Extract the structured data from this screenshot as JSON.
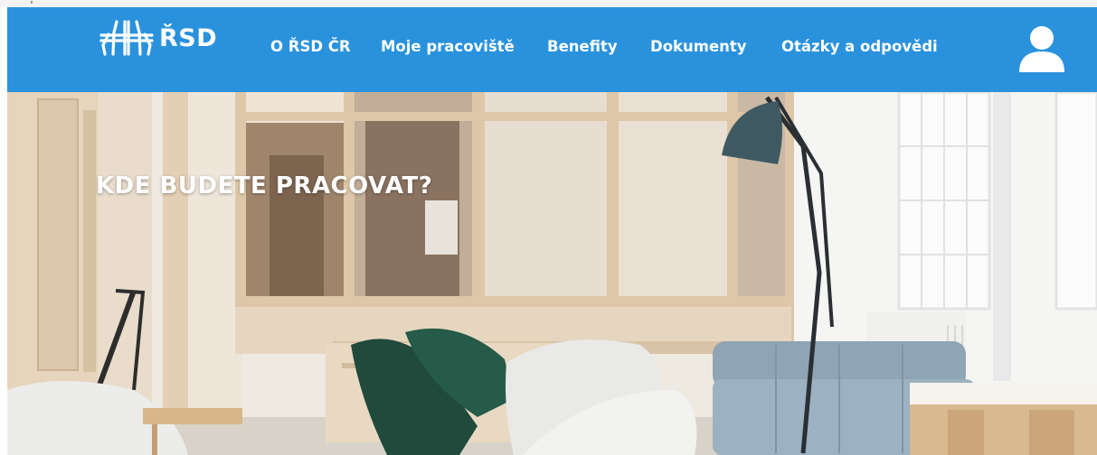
{
  "brand": {
    "logo_text": "ŘSD",
    "logo_icon": "highway-logo-icon"
  },
  "nav": {
    "items": [
      {
        "label": "O ŘSD ČR"
      },
      {
        "label": "Moje pracoviště"
      },
      {
        "label": "Benefity"
      },
      {
        "label": "Dokumenty"
      },
      {
        "label": "Otázky a odpovědi"
      }
    ],
    "user_icon": "user-icon"
  },
  "hero": {
    "title": "KDE BUDETE PRACOVAT?",
    "image": "office-interior-photo"
  },
  "colors": {
    "header": "#2a92dd",
    "text_on_header": "#ffffff"
  }
}
